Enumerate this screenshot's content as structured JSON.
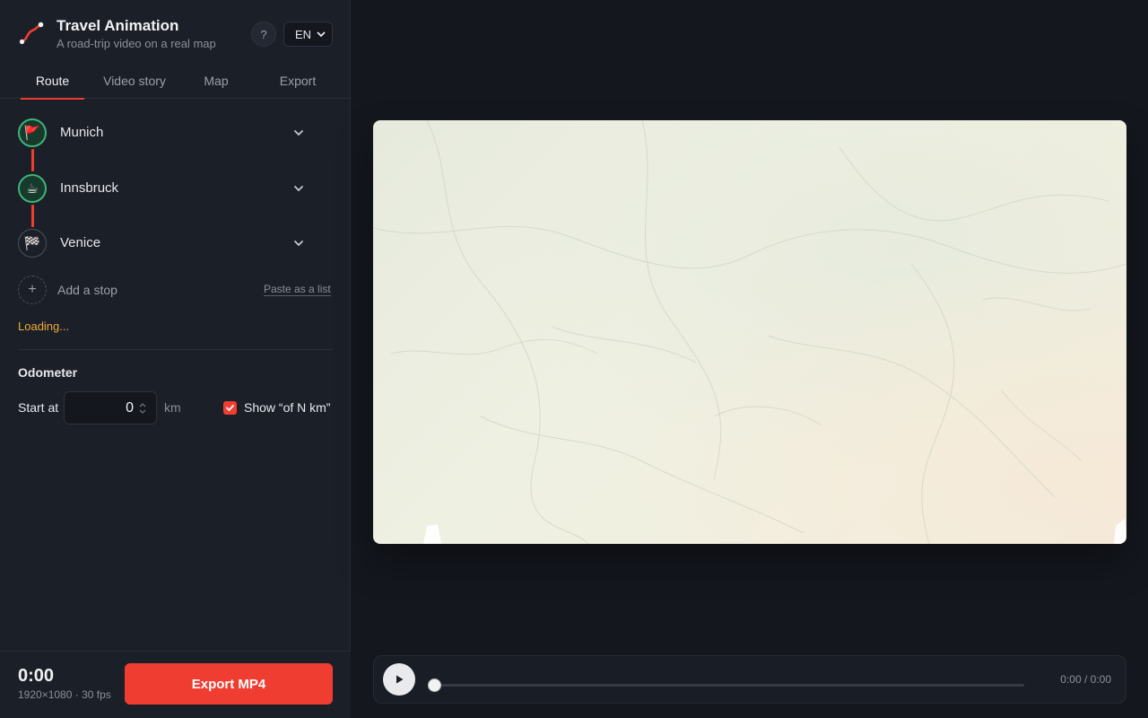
{
  "app": {
    "title": "Travel Animation",
    "subtitle": "A road-trip video on a real map",
    "help_label": "?",
    "language": "EN"
  },
  "tabs": [
    {
      "label": "Route",
      "active": true
    },
    {
      "label": "Video story",
      "active": false
    },
    {
      "label": "Map",
      "active": false
    },
    {
      "label": "Export",
      "active": false
    }
  ],
  "route": {
    "stops": [
      {
        "label": "Munich",
        "icon": "🚩",
        "icon_name": "flag-icon"
      },
      {
        "label": "Innsbruck",
        "icon": "☕",
        "icon_name": "coffee-icon"
      },
      {
        "label": "Venice",
        "icon": "🏁",
        "icon_name": "checkered-flag-icon"
      }
    ],
    "add_stop_icon": "+",
    "add_stop_label": "Add a stop",
    "paste_link": "Paste as a list",
    "status": "Loading..."
  },
  "odometer": {
    "title": "Odometer",
    "start_label": "Start at",
    "start_value": "0",
    "unit": "km",
    "show_total_label": "Show “of N km”",
    "show_total_checked": true
  },
  "footer": {
    "time": "0:00",
    "resolution_info": "1920×1080 · 30 fps",
    "export_label": "Export MP4"
  },
  "player": {
    "time_readout": "0:00 / 0:00",
    "progress": 0
  },
  "colors": {
    "accent": "#f03d32",
    "stop_ring": "#3fb37a",
    "loading": "#f0a93a"
  }
}
